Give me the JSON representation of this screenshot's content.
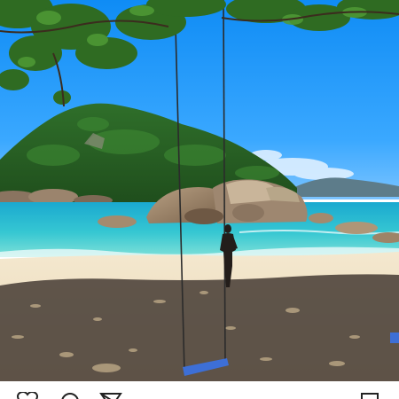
{
  "photo": {
    "subject": "beach-with-rope-swing"
  },
  "action_bar": {
    "icons": [
      "heart-icon",
      "comment-icon",
      "share-icon",
      "bookmark-icon"
    ]
  },
  "colors": {
    "sky": "#1f9bff",
    "sea": "#31c6d6",
    "sand": "#efe1c4",
    "shade": "#4a4038",
    "foliage": "#2f6b22",
    "swing_seat": "#3d6fd6"
  }
}
